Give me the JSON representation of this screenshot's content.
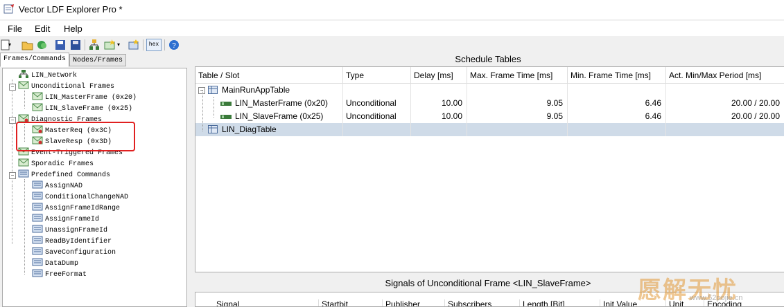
{
  "window": {
    "title": "Vector LDF Explorer Pro *"
  },
  "menu": {
    "items": [
      "File",
      "Edit",
      "Help"
    ]
  },
  "toolbar": {
    "hex_label": "hex"
  },
  "tabs": [
    "Frames/Commands",
    "Nodes/Frames"
  ],
  "tree": {
    "items": [
      {
        "label": "LIN_Network"
      },
      {
        "label": "Unconditional Frames"
      },
      {
        "label": "LIN_MasterFrame (0x20)"
      },
      {
        "label": "LIN_SlaveFrame (0x25)"
      },
      {
        "label": "Diagnostic Frames"
      },
      {
        "label": "MasterReq (0x3C)"
      },
      {
        "label": "SlaveResp (0x3D)"
      },
      {
        "label": "Event-Triggered Frames"
      },
      {
        "label": "Sporadic Frames"
      },
      {
        "label": "Predefined Commands"
      },
      {
        "label": "AssignNAD"
      },
      {
        "label": "ConditionalChangeNAD"
      },
      {
        "label": "AssignFrameIdRange"
      },
      {
        "label": "AssignFrameId"
      },
      {
        "label": "UnassignFrameId"
      },
      {
        "label": "ReadByIdentifier"
      },
      {
        "label": "SaveConfiguration"
      },
      {
        "label": "DataDump"
      },
      {
        "label": "FreeFormat"
      }
    ]
  },
  "schedule": {
    "title": "Schedule Tables",
    "columns": [
      "Table / Slot",
      "Type",
      "Delay [ms]",
      "Max. Frame Time [ms]",
      "Min. Frame Time [ms]",
      "Act. Min/Max Period [ms]"
    ],
    "rows": [
      {
        "slot": "MainRunAppTable",
        "type": "",
        "delay": "",
        "max": "",
        "min": "",
        "period": ""
      },
      {
        "slot": "LIN_MasterFrame (0x20)",
        "type": "Unconditional",
        "delay": "10.00",
        "max": "9.05",
        "min": "6.46",
        "period": "20.00 / 20.00"
      },
      {
        "slot": "LIN_SlaveFrame (0x25)",
        "type": "Unconditional",
        "delay": "10.00",
        "max": "9.05",
        "min": "6.46",
        "period": "20.00 / 20.00"
      },
      {
        "slot": "LIN_DiagTable",
        "type": "",
        "delay": "",
        "max": "",
        "min": "",
        "period": ""
      }
    ]
  },
  "signals": {
    "title": "Signals of Unconditional Frame <LIN_SlaveFrame>",
    "columns": [
      "Signal",
      "Startbit",
      "Publisher",
      "Subscribers",
      "Length [Bit]",
      "Init Value",
      "Unit",
      "Encoding"
    ]
  },
  "watermark": {
    "text": "愿解无忧",
    "sub": "www.52pojie.cn"
  },
  "colors": {
    "selection": "#cfdbe8",
    "highlight_box": "#e02020"
  }
}
